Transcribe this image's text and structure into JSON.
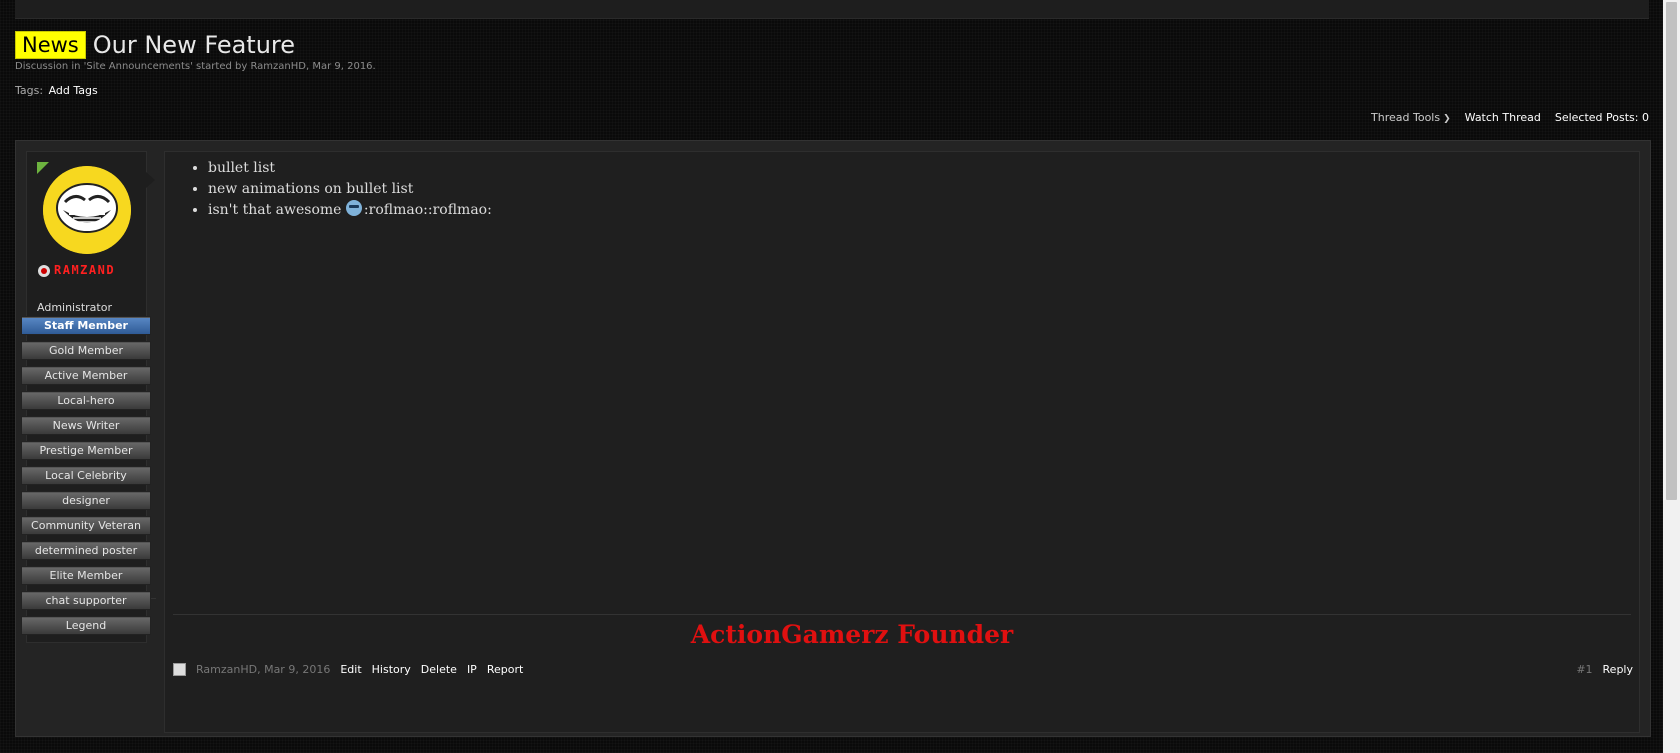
{
  "thread": {
    "prefix": "News",
    "title": "Our New Feature",
    "description": "Discussion in 'Site Announcements' started by RamzanHD, Mar 9, 2016.",
    "tags_label": "Tags:",
    "add_tags": "Add Tags"
  },
  "thread_tools": {
    "tools_label": "Thread Tools",
    "watch_label": "Watch Thread",
    "selected_label": "Selected Posts: 0"
  },
  "user": {
    "name": "RAMZAND",
    "role": "Administrator",
    "banners": [
      "Staff Member",
      "Gold Member",
      "Active Member",
      "Local-hero",
      "News Writer",
      "Prestige Member",
      "Local Celebrity",
      "designer",
      "Community Veteran",
      "determined poster",
      "Elite Member",
      "chat supporter",
      "Legend"
    ]
  },
  "post": {
    "bullets": [
      "bullet list",
      "new animations on bullet list",
      "isn't that awesome"
    ],
    "bullet3_suffix": ":roflmao::roflmao:",
    "signature": "ActionGamerz Founder",
    "author_date": "RamzanHD, Mar 9, 2016",
    "actions": [
      "Edit",
      "History",
      "Delete",
      "IP",
      "Report"
    ],
    "number": "#1",
    "reply": "Reply"
  }
}
